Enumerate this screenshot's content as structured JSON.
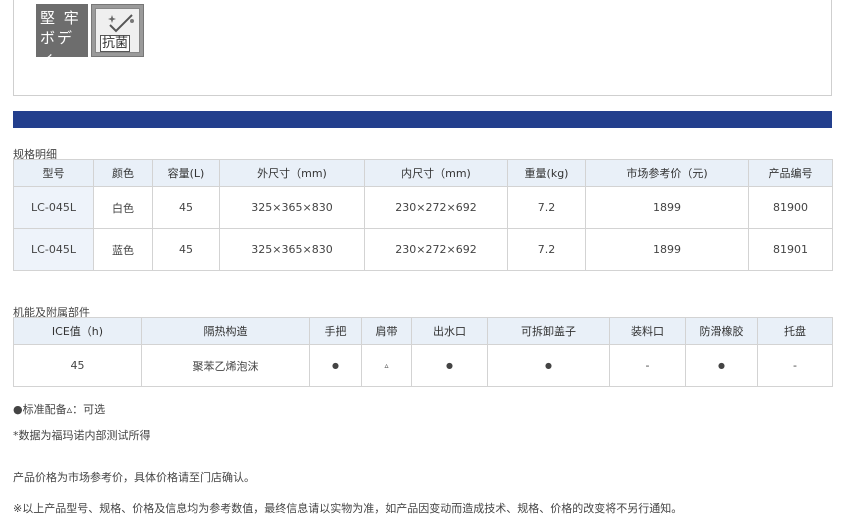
{
  "badges": {
    "dark_line1": "堅 牢",
    "dark_line2": "ボディ",
    "light_text": "抗菌"
  },
  "spec": {
    "title": "规格明细",
    "headers": [
      "型号",
      "颜色",
      "容量(L)",
      "外尺寸（mm)",
      "内尺寸（mm)",
      "重量(kg)",
      "市场参考价（元)",
      "产品编号"
    ],
    "rows": [
      [
        "LC-045L",
        "白色",
        "45",
        "325×365×830",
        "230×272×692",
        "7.2",
        "1899",
        "81900"
      ],
      [
        "LC-045L",
        "蓝色",
        "45",
        "325×365×830",
        "230×272×692",
        "7.2",
        "1899",
        "81901"
      ]
    ]
  },
  "features": {
    "title": "机能及附属部件",
    "headers": [
      "ICE值（h)",
      "隔热构造",
      "手把",
      "肩带",
      "出水口",
      "可拆卸盖子",
      "装料口",
      "防滑橡胶",
      "托盘"
    ],
    "row": [
      "45",
      "聚苯乙烯泡沫",
      "●",
      "▵",
      "●",
      "●",
      "-",
      "●",
      "-"
    ]
  },
  "notes": {
    "legend": "●标准配备▵：可选",
    "data_note": "*数据为福玛诺内部测试所得",
    "price_note": "产品价格为市场参考价，具体价格请至门店确认。",
    "disclaimer": "※以上产品型号、规格、价格及信息均为参考数值，最终信息请以实物为准，如产品因变动而造成技术、规格、价格的改变将不另行通知。"
  },
  "colors": {
    "accent_bar": "#233f8d",
    "header_bg": "#e9f0f8"
  }
}
